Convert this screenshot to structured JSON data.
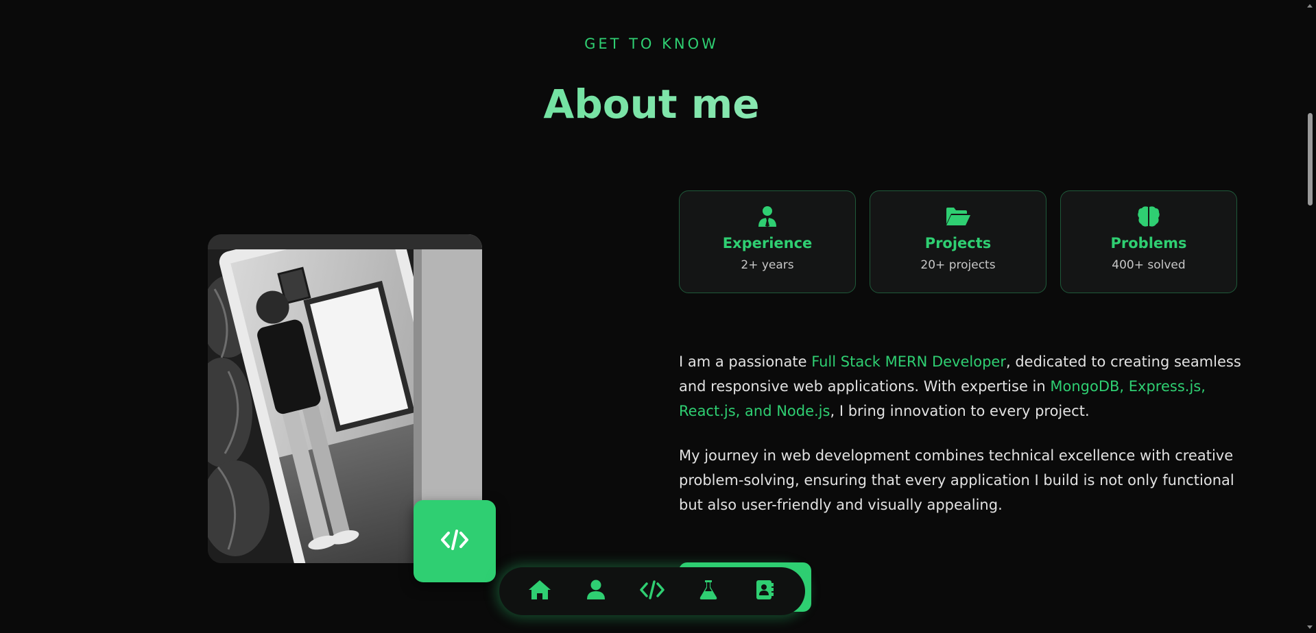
{
  "section": {
    "eyebrow": "GET TO KNOW",
    "title": "About me"
  },
  "stats": [
    {
      "icon": "user-tie-icon",
      "title": "Experience",
      "subtitle": "2+ years"
    },
    {
      "icon": "folder-open-icon",
      "title": "Projects",
      "subtitle": "20+ projects"
    },
    {
      "icon": "brain-icon",
      "title": "Problems",
      "subtitle": "400+ solved"
    }
  ],
  "bio": {
    "p1_a": "I am a passionate ",
    "p1_hl1": "Full Stack MERN Developer",
    "p1_b": ", dedicated to creating seamless and responsive web applications. With expertise in ",
    "p1_hl2": "MongoDB, Express.js, React.js, and Node.js",
    "p1_c": ", I bring innovation to every project.",
    "p2": "My journey in web development combines technical excellence with creative problem-solving, ensuring that every application I build is not only functional but also user-friendly and visually appealing."
  },
  "nav": {
    "items": [
      "home-icon",
      "user-icon",
      "code-icon",
      "flask-icon",
      "address-book-icon"
    ]
  },
  "colors": {
    "accent": "#2fcf72",
    "background": "#0a0a0a",
    "card_bg": "#141515",
    "card_border": "#1f5a3a"
  }
}
